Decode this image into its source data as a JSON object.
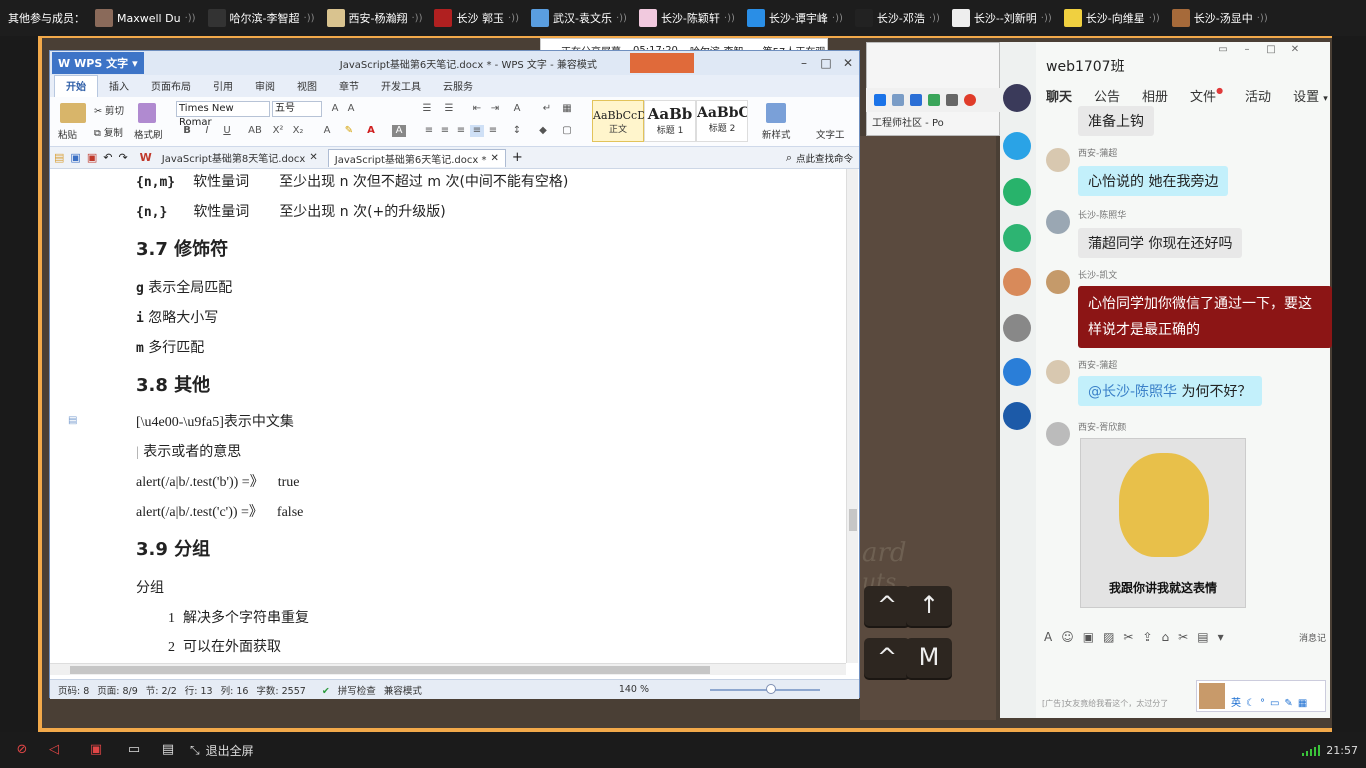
{
  "member_bar": {
    "title": "其他参与成员：",
    "members": [
      "Maxwell Du",
      "哈尔滨-李智超",
      "西安-杨瀚翔",
      "长沙 郭玉",
      "武汉-袁文乐",
      "长沙-陈颖轩",
      "长沙-谭宇峰",
      "长沙-邓浩",
      "长沙--刘新明",
      "长沙-向维星",
      "长沙-汤显中"
    ]
  },
  "share_notice": {
    "status": "正在分享屏幕",
    "time": "05:17:20",
    "viewers": "哈尔滨-李智......等57人正在观"
  },
  "wps": {
    "app_button": "WPS 文字",
    "window_title": "JavaScript基础第6天笔记.docx * - WPS 文字 - 兼容模式",
    "menus": [
      "开始",
      "插入",
      "页面布局",
      "引用",
      "审阅",
      "视图",
      "章节",
      "开发工具",
      "云服务"
    ],
    "ribbon": {
      "paste": "粘贴",
      "cut": "剪切",
      "copy": "复制",
      "format_painter": "格式刷",
      "font": "Times New Romar",
      "size": "五号",
      "styles": [
        {
          "sample": "AaBbCcD",
          "name": "正文"
        },
        {
          "sample": "AaBb",
          "name": "标题 1"
        },
        {
          "sample": "AaBbC",
          "name": "标题 2"
        }
      ],
      "new_style": "新样式",
      "text_tool": "文字工"
    },
    "doc_tabs": [
      "JavaScript基础第8天笔记.docx",
      "JavaScript基础第6天笔记.docx *"
    ],
    "find_cmd": "点此查找命令",
    "doc": {
      "line1_code": "{n,m}",
      "line1_label": "软性量词",
      "line1_desc": "至少出现 n 次但不超过 m 次(中间不能有空格)",
      "line2_code": "{n,}",
      "line2_label": "软性量词",
      "line2_desc": "至少出现 n 次(+的升级版)",
      "h37": "3.7 修饰符",
      "g_code": "g",
      "g_desc": "表示全局匹配",
      "i_code": "i",
      "i_desc": "忽略大小写",
      "m_code": "m",
      "m_desc": "多行匹配",
      "h38": "3.8 其他",
      "range_code": "[\\u4e00-\\u9fa5]",
      "range_desc": "表示中文集",
      "pipe_code": "|",
      "pipe_desc": "表示或者的意思",
      "test1": "alert(/a|b/.test('b')) =》",
      "test1_res": "true",
      "test2": "alert(/a|b/.test('c')) =》",
      "test2_res": "false",
      "h39": "3.9 分组",
      "group": "分组",
      "item1_no": "1",
      "item1": "解决多个字符串重复",
      "item2_no": "2",
      "item2": "可以在外面获取"
    },
    "status": {
      "page": "页码: 8",
      "pages": "页面: 8/9",
      "section": "节: 2/2",
      "row": "行: 13",
      "col": "列: 16",
      "words": "字数: 2557",
      "spell": "拼写检查",
      "mode": "兼容模式",
      "zoom": "140 %"
    }
  },
  "browser": {
    "url_text": "工程师社区 - Po"
  },
  "desktop": {
    "key1": "^",
    "key2": "↑",
    "key3": "^",
    "key4": "M",
    "word1": "ard",
    "word2": "uts"
  },
  "chat": {
    "group_name": "web1707班",
    "tabs": [
      "聊天",
      "公告",
      "相册",
      "文件",
      "活动",
      "设置"
    ],
    "messages": [
      {
        "name": "",
        "text": "准备上钩",
        "style": "gray"
      },
      {
        "name": "西安-蒲超",
        "text": "心怡说的  她在我旁边",
        "style": "blue"
      },
      {
        "name": "长沙-陈照华",
        "text": "蒲超同学 你现在还好吗",
        "style": "gray"
      },
      {
        "name": "长沙-凯文",
        "text": "心怡同学加你微信了通过一下，要这样说才是最正确的",
        "style": "red"
      },
      {
        "name": "西安-蒲超",
        "mention": "@长沙-陈照华",
        "text": "为何不好？",
        "style": "blue"
      },
      {
        "name": "西安-胥欣颜",
        "image_caption": "我跟你讲我就这表情"
      }
    ],
    "toolbar_record": "消息记",
    "ad": "[广告]女友竟给我看这个，太过分了",
    "ime_label": "英"
  },
  "bottom_bar": {
    "exit_fullscreen": "退出全屏",
    "clock": "21:57"
  }
}
